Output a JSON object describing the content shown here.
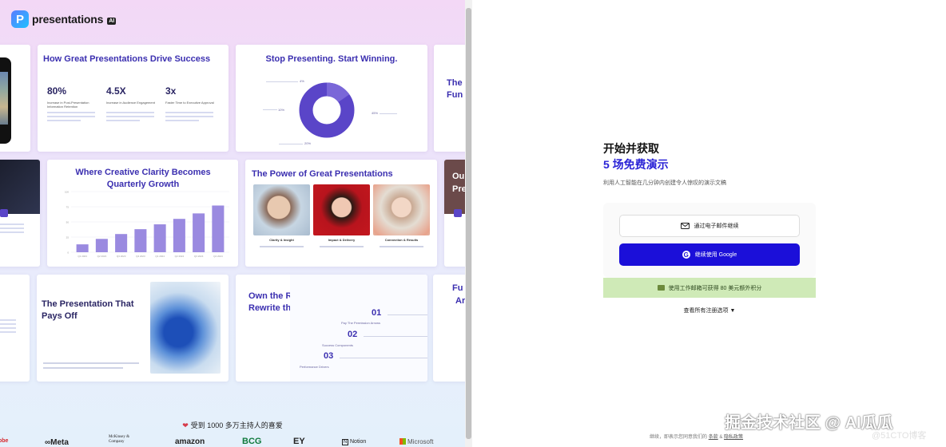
{
  "brand": {
    "name": "presentations",
    "badge": "AI",
    "mark": "P"
  },
  "cards": {
    "c2": {
      "title": "How Great Presentations Drive Success",
      "stats": [
        {
          "value": "80%",
          "label": "Increase in Post-Presentation Information Retention"
        },
        {
          "value": "4.5X",
          "label": "Increase in Audience Engagement"
        },
        {
          "value": "3x",
          "label": "Faster Time to Executive Approval"
        }
      ]
    },
    "c3": {
      "title": "Stop Presenting. Start Winning.",
      "pie_labels": [
        "4%",
        "10%",
        "45%",
        "20%"
      ]
    },
    "c4": {
      "title_a": "The",
      "title_b": "Fun"
    },
    "c6": {
      "title": "Where Creative Clarity Becomes Quarterly Growth"
    },
    "c7": {
      "title": "The Power of Great Presentations",
      "captions": [
        "Clarity & Insight",
        "Impact & Delivery",
        "Connection & Results"
      ]
    },
    "c8": {
      "title_a": "Ou",
      "title_b": "Pre"
    },
    "c9": {
      "label": "Pays Off"
    },
    "c10": {
      "title": "The Presentation That Pays Off"
    },
    "c11": {
      "title": "Own the Room and Rewrite the Rules",
      "steps": [
        {
          "num": "01",
          "label": "Pay The Permission Arrows"
        },
        {
          "num": "02",
          "label": "Success Components"
        },
        {
          "num": "03",
          "label": "Performance Drivers"
        }
      ]
    },
    "c12": {
      "title_a": "Fu",
      "title_b": "Ar"
    }
  },
  "chart_data": {
    "type": "bar",
    "title": "Where Creative Clarity Becomes Quarterly Growth",
    "categories": [
      "Q1 2023",
      "Q2 2023",
      "Q3 2023",
      "Q4 2023",
      "Q1 2024",
      "Q2 2024",
      "Q3 2024",
      "Q4 2024"
    ],
    "values": [
      13,
      22,
      30,
      38,
      46,
      55,
      64,
      77
    ],
    "ylim": [
      0,
      100
    ],
    "color": "#9a8ae0",
    "grid": true
  },
  "loved": {
    "text": "受到 1000 多万主持人的喜爱"
  },
  "brand_logos": [
    "obe",
    "∞Meta",
    "McKinsey & Company",
    "amazon",
    "BCG",
    "EY",
    "Notion",
    "Microsoft"
  ],
  "signup": {
    "title": "开始并获取",
    "subtitle": "5 场免费演示",
    "description": "利用人工智能在几分钟内创建令人惊叹的演示文稿",
    "email_button": "通过电子邮件继续",
    "google_button": "继续使用 Google",
    "promo": "使用工作邮箱可获得 80 美元额外积分",
    "more_options": "查看所有注册选项",
    "footer_prefix": "继续，即表示您同意我们的",
    "terms": "条款",
    "privacy": "隐私政策"
  },
  "watermark": {
    "text": "掘金技术社区 @ AI瓜瓜",
    "sub": "@51CTO博客"
  },
  "colors": {
    "accent": "#1b0fd9",
    "title_blue": "#3b2fb0",
    "promo_bg": "#cfeab7"
  }
}
